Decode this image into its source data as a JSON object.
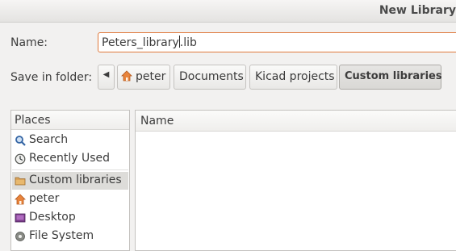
{
  "window": {
    "title": "New Library"
  },
  "name_field": {
    "label": "Name:",
    "value_before_cursor": "Peters_library",
    "value_after_cursor": ".lib"
  },
  "save_in": {
    "label": "Save in folder:",
    "crumbs": [
      "peter",
      "Documents",
      "Kicad projects",
      "Custom libraries"
    ]
  },
  "places": {
    "header": "Places",
    "items": [
      {
        "label": "Search",
        "icon": "magnifier-icon"
      },
      {
        "label": "Recently Used",
        "icon": "clock-icon"
      },
      {
        "label": "Custom libraries",
        "icon": "folder-icon",
        "selected": true
      },
      {
        "label": "peter",
        "icon": "home-icon"
      },
      {
        "label": "Desktop",
        "icon": "desktop-icon"
      },
      {
        "label": "File System",
        "icon": "drive-icon"
      }
    ]
  },
  "files": {
    "column_name": "Name"
  },
  "colors": {
    "accent": "#e07a3d",
    "selection": "#dddcd9"
  }
}
